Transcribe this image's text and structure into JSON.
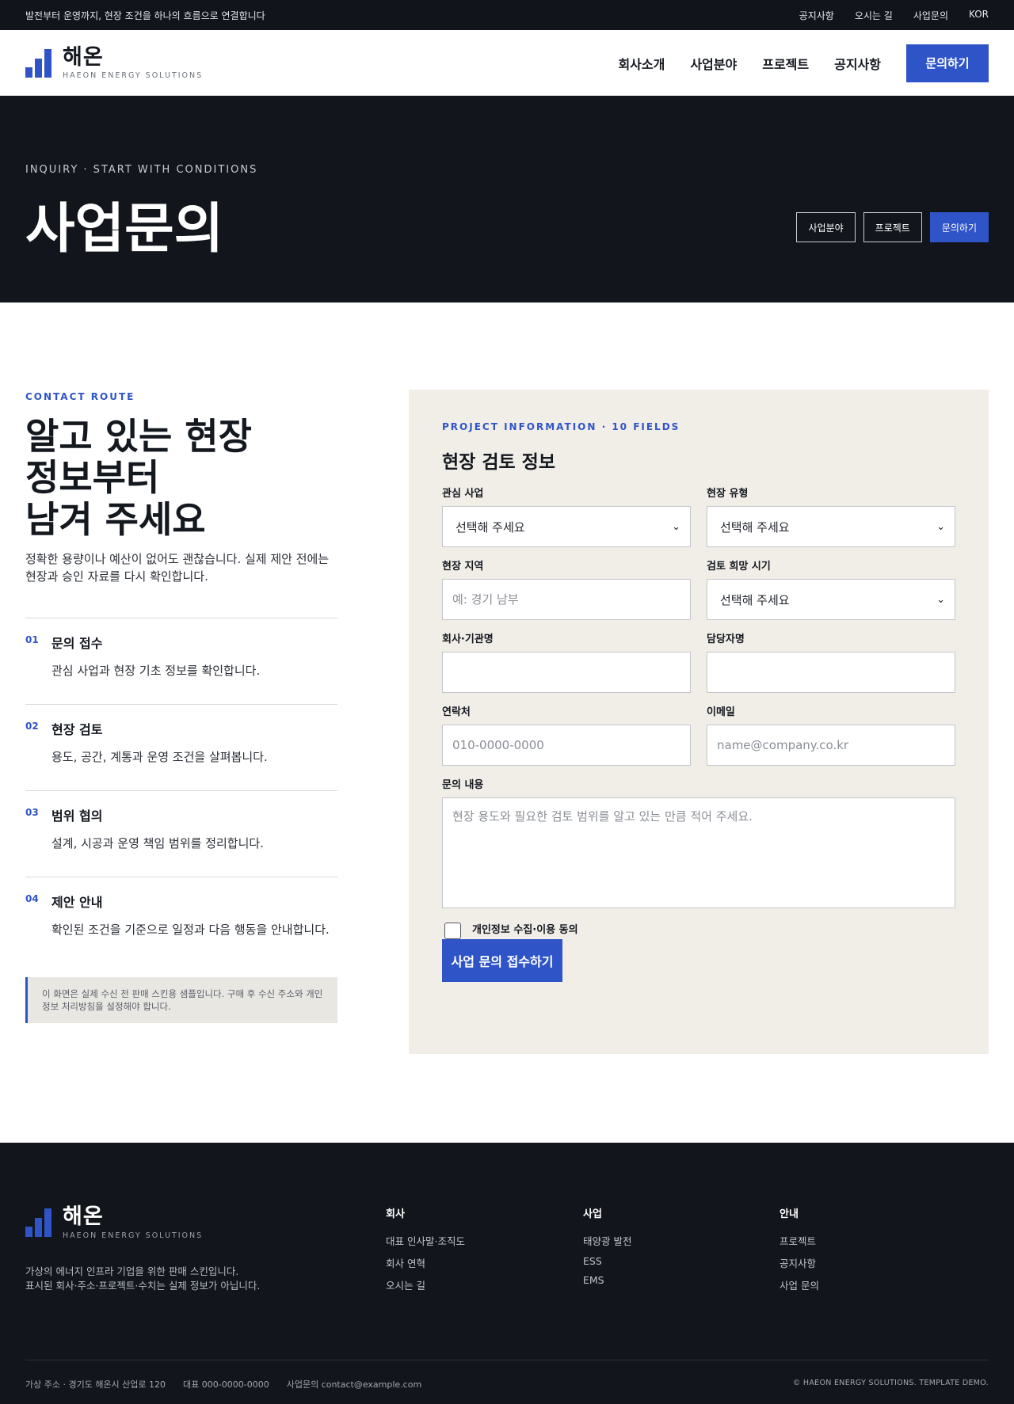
{
  "topbar": {
    "tagline": "발전부터 운영까지, 현장 조건을 하나의 흐름으로 연결합니다",
    "links": [
      "공지사항",
      "오시는 길",
      "사업문의",
      "KOR"
    ]
  },
  "brand": {
    "name": "해온",
    "sub": "HAEON ENERGY SOLUTIONS",
    "accent": "#2f54c8"
  },
  "nav": {
    "items": [
      "회사소개",
      "사업분야",
      "프로젝트",
      "공지사항"
    ],
    "cta": "문의하기"
  },
  "hero": {
    "eyebrow": "INQUIRY · START WITH CONDITIONS",
    "title": "사업문의",
    "buttons": [
      "사업분야",
      "프로젝트",
      "문의하기"
    ]
  },
  "intro": {
    "label": "CONTACT ROUTE",
    "heading_lines": [
      "알고 있는 현장",
      "정보부터",
      "남겨 주세요"
    ],
    "desc": "정확한 용량이나 예산이 없어도 괜찮습니다. 실제 제안 전에는 현장과 승인 자료를 다시 확인합니다.",
    "steps": [
      {
        "num": "01",
        "title": "문의 접수",
        "text": "관심 사업과 현장 기초 정보를 확인합니다."
      },
      {
        "num": "02",
        "title": "현장 검토",
        "text": "용도, 공간, 계통과 운영 조건을 살펴봅니다."
      },
      {
        "num": "03",
        "title": "범위 협의",
        "text": "설계, 시공과 운영 책임 범위를 정리합니다."
      },
      {
        "num": "04",
        "title": "제안 안내",
        "text": "확인된 조건을 기준으로 일정과 다음 행동을 안내합니다."
      }
    ],
    "notice": "이 화면은 실제 수신 전 판매 스킨용 샘플입니다. 구매 후 수신 주소와 개인정보 처리방침을 설정해야 합니다."
  },
  "form": {
    "label": "PROJECT INFORMATION · 10 FIELDS",
    "title": "현장 검토 정보",
    "interest": {
      "label": "관심 사업",
      "value": "선택해 주세요"
    },
    "site_type": {
      "label": "현장 유형",
      "value": "선택해 주세요"
    },
    "region": {
      "label": "현장 지역",
      "placeholder": "예: 경기 남부"
    },
    "timing": {
      "label": "검토 희망 시기",
      "value": "선택해 주세요"
    },
    "company": {
      "label": "회사·기관명",
      "placeholder": ""
    },
    "manager": {
      "label": "담당자명",
      "placeholder": ""
    },
    "phone": {
      "label": "연락처",
      "placeholder": "010-0000-0000"
    },
    "email": {
      "label": "이메일",
      "placeholder": "name@company.co.kr"
    },
    "message": {
      "label": "문의 내용",
      "placeholder": "현장 용도와 필요한 검토 범위를 알고 있는 만큼 적어 주세요."
    },
    "consent": "개인정보 수집·이용 동의",
    "submit": "사업 문의 접수하기"
  },
  "footer": {
    "intro_lines": [
      "가상의 에너지 인프라 기업을 위한 판매 스킨입니다.",
      "표시된 회사·주소·프로젝트·수치는 실제 정보가 아닙니다."
    ],
    "columns": [
      {
        "title": "회사",
        "links": [
          "대표 인사말·조직도",
          "회사 연혁",
          "오시는 길"
        ]
      },
      {
        "title": "사업",
        "links": [
          "태양광 발전",
          "ESS",
          "EMS"
        ]
      },
      {
        "title": "안내",
        "links": [
          "프로젝트",
          "공지사항",
          "사업 문의"
        ]
      }
    ],
    "address": "가상 주소 · 경기도 해온시 산업로 120",
    "tel": "대표 000-0000-0000",
    "email": "사업문의 contact@example.com",
    "copyright": "© HAEON ENERGY SOLUTIONS. TEMPLATE DEMO."
  }
}
